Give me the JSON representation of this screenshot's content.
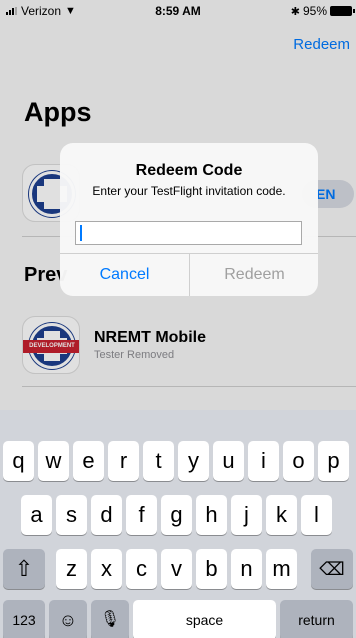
{
  "status_bar": {
    "carrier": "Verizon",
    "time": "8:59 AM",
    "battery": "95%"
  },
  "nav": {
    "redeem_label": "Redeem"
  },
  "apps_section": {
    "title": "Apps",
    "open_label": "EN"
  },
  "previous_section": {
    "title": "Prev",
    "app": {
      "name": "NREMT Mobile",
      "status": "Tester Removed",
      "badge_text": "DEVELOPMENT"
    }
  },
  "alert": {
    "title": "Redeem Code",
    "message": "Enter your TestFlight invitation code.",
    "input_value": "",
    "cancel_label": "Cancel",
    "redeem_label": "Redeem"
  },
  "keyboard": {
    "row1": [
      "q",
      "w",
      "e",
      "r",
      "t",
      "y",
      "u",
      "i",
      "o",
      "p"
    ],
    "row2": [
      "a",
      "s",
      "d",
      "f",
      "g",
      "h",
      "j",
      "k",
      "l"
    ],
    "row3": [
      "z",
      "x",
      "c",
      "v",
      "b",
      "n",
      "m"
    ],
    "numbers_label": "123",
    "space_label": "space",
    "return_label": "return"
  },
  "colors": {
    "accent": "#007aff",
    "badge_blue": "#1d3f8f",
    "badge_red": "#c8202f"
  }
}
